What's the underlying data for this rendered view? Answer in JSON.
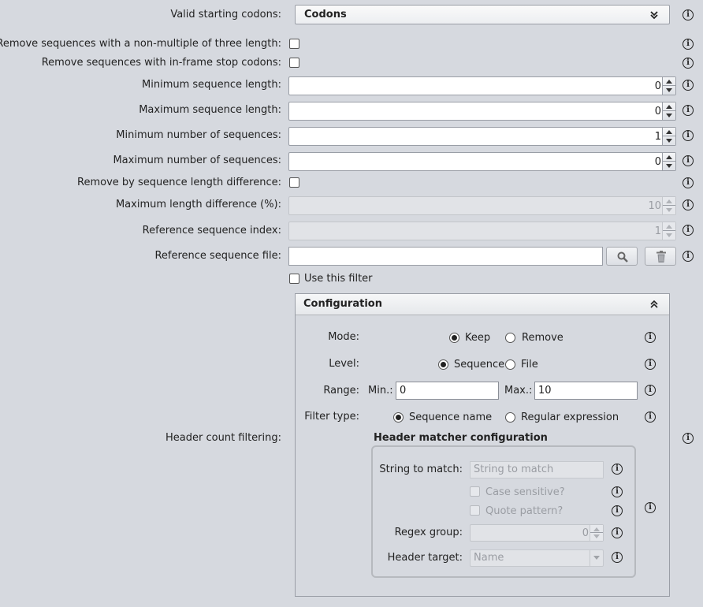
{
  "codons": {
    "label": "Valid starting codons:",
    "value": "Codons"
  },
  "remove_non_multiple": {
    "label": "Remove sequences with a non-multiple of three length:"
  },
  "remove_stop": {
    "label": "Remove sequences with in-frame stop codons:"
  },
  "min_len": {
    "label": "Minimum sequence length:",
    "value": "0"
  },
  "max_len": {
    "label": "Maximum sequence length:",
    "value": "0"
  },
  "min_num": {
    "label": "Minimum number of sequences:",
    "value": "1"
  },
  "max_num": {
    "label": "Maximum number of sequences:",
    "value": "0"
  },
  "remove_diff": {
    "label": "Remove by sequence length difference:"
  },
  "max_diff": {
    "label": "Maximum length difference (%):",
    "value": "10"
  },
  "ref_index": {
    "label": "Reference sequence index:",
    "value": "1"
  },
  "ref_file": {
    "label": "Reference sequence file:",
    "value": ""
  },
  "use_filter": {
    "label": "Use this filter"
  },
  "header_count": {
    "label": "Header count filtering:"
  },
  "config": {
    "title": "Configuration",
    "mode": {
      "label": "Mode:",
      "options": [
        "Keep",
        "Remove"
      ],
      "selected": "Keep"
    },
    "level": {
      "label": "Level:",
      "options": [
        "Sequence",
        "File"
      ],
      "selected": "Sequence"
    },
    "range": {
      "label": "Range:",
      "min_label": "Min.:",
      "min": "0",
      "max_label": "Max.:",
      "max": "10"
    },
    "filter_type": {
      "label": "Filter type:",
      "options": [
        "Sequence name",
        "Regular expression"
      ],
      "selected": "Sequence name"
    },
    "matcher": {
      "title": "Header matcher configuration",
      "string_label": "String to match:",
      "string_placeholder": "String to match",
      "case_label": "Case sensitive?",
      "quote_label": "Quote pattern?",
      "regex_label": "Regex group:",
      "regex_value": "0",
      "target_label": "Header target:",
      "target_value": "Name"
    }
  },
  "icons": {
    "info": "info-icon",
    "search": "search-icon",
    "trash": "trash-icon",
    "collapse": "chevron-up-double-icon",
    "expand": "chevron-down-double-icon"
  }
}
